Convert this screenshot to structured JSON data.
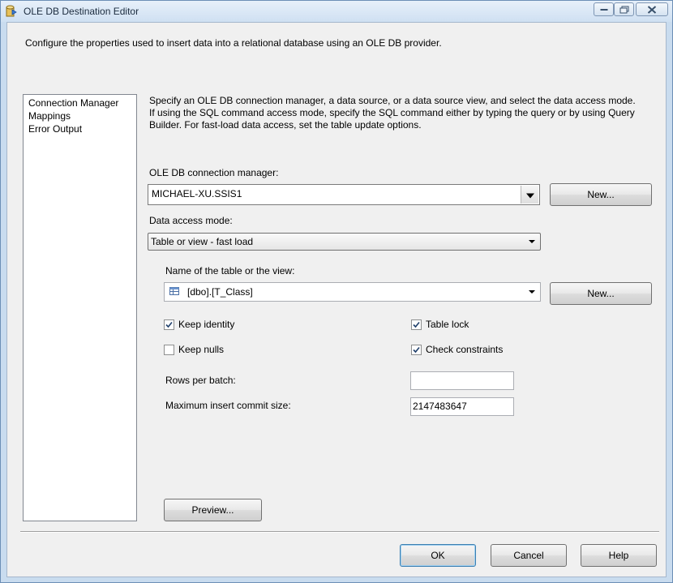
{
  "window": {
    "title": "OLE DB Destination Editor",
    "header_description": "Configure the properties used to insert data into a relational database using an OLE DB provider."
  },
  "nav": {
    "items": [
      {
        "label": "Connection Manager"
      },
      {
        "label": "Mappings"
      },
      {
        "label": "Error Output"
      }
    ]
  },
  "panel": {
    "description": "Specify an OLE DB connection manager, a data source, or a data source view, and select the data access mode. If using the SQL command access mode, specify the SQL command either by typing the query or by using Query Builder. For fast-load data access, set the table update options.",
    "connection_manager": {
      "label": "OLE DB connection manager:",
      "value": "MICHAEL-XU.SSIS1",
      "new_button": "New..."
    },
    "data_access_mode": {
      "label": "Data access mode:",
      "value": "Table or view - fast load"
    },
    "table": {
      "label": "Name of the table or the view:",
      "value": "[dbo].[T_Class]",
      "new_button": "New..."
    },
    "options": {
      "keep_identity": {
        "label": "Keep identity",
        "checked": true
      },
      "table_lock": {
        "label": "Table lock",
        "checked": true
      },
      "keep_nulls": {
        "label": "Keep nulls",
        "checked": false
      },
      "check_constraints": {
        "label": "Check constraints",
        "checked": true
      }
    },
    "rows_per_batch": {
      "label": "Rows per batch:",
      "value": ""
    },
    "max_commit": {
      "label": "Maximum insert commit size:",
      "value": "2147483647"
    },
    "preview_button": "Preview..."
  },
  "footer": {
    "ok": "OK",
    "cancel": "Cancel",
    "help": "Help"
  }
}
